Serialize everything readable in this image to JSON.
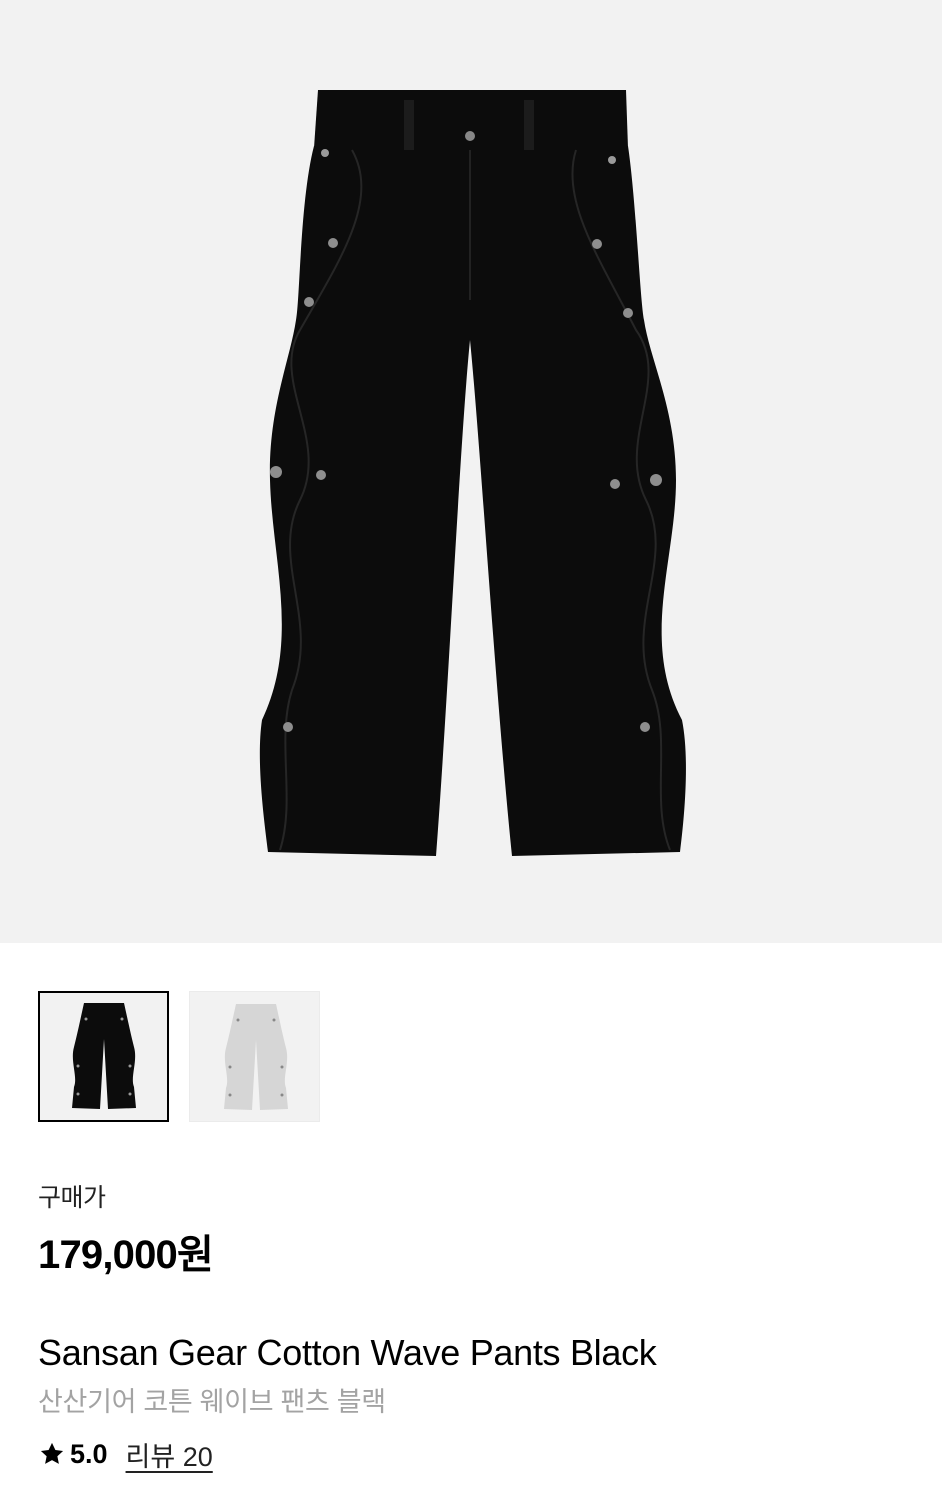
{
  "product": {
    "price_label": "구매가",
    "price": "179,000원",
    "name_en": "Sansan Gear Cotton Wave Pants Black",
    "name_ko": "산산기어 코튼 웨이브 팬츠 블랙"
  },
  "rating": {
    "icon": "star-icon",
    "score": "5.0",
    "review_link": "리뷰 20"
  },
  "thumbnails": [
    {
      "color": "black",
      "selected": true
    },
    {
      "color": "light-gray",
      "selected": false
    }
  ],
  "colors": {
    "hero_bg": "#f2f2f2",
    "pants_black": "#0c0c0c",
    "pants_gray": "#d6d6d6",
    "secondary_text": "#a3a3a3"
  }
}
